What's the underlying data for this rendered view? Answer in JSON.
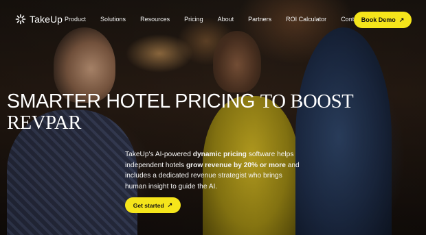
{
  "brand": {
    "name": "TakeUp",
    "icon": "takeup-logo-icon"
  },
  "nav": {
    "items": [
      {
        "label": "Product"
      },
      {
        "label": "Solutions"
      },
      {
        "label": "Resources"
      },
      {
        "label": "Pricing"
      },
      {
        "label": "About"
      },
      {
        "label": "Partners"
      },
      {
        "label": "ROI Calculator"
      },
      {
        "label": "Contact Us"
      }
    ],
    "cta_label": "Book Demo",
    "cta_icon": "arrow-up-right-icon"
  },
  "hero": {
    "headline_sans": "SMARTER HOTEL PRICING",
    "headline_serif": "TO BOOST REVPAR",
    "description": {
      "p1": "TakeUp's AI-powered ",
      "b1": "dynamic pricing",
      "p2": " software helps independent hotels ",
      "b2": "grow revenue by 20% or more",
      "p3": " and includes a dedicated revenue strategist who brings human insight to guide the AI."
    },
    "cta_label": "Get started",
    "cta_icon": "arrow-up-right-icon"
  },
  "colors": {
    "accent": "#f5e51b",
    "text": "#ffffff"
  }
}
